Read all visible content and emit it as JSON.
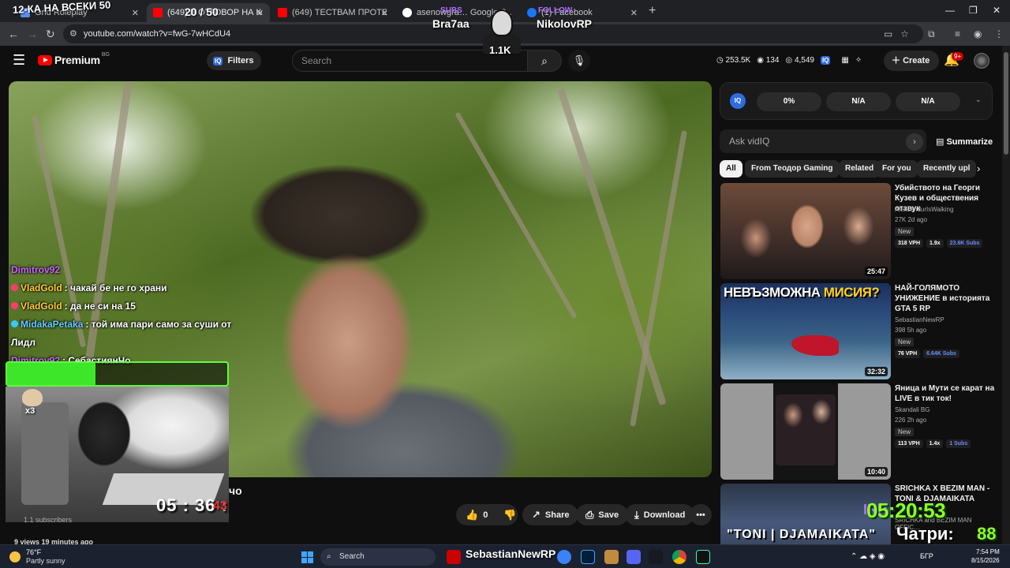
{
  "browser": {
    "tabs": [
      {
        "title": "Grid Roleplay",
        "favicon_color": "#5a8dee"
      },
      {
        "title": "(649) В ОТГОВОР НА КОМ",
        "favicon_color": "#ff0000"
      },
      {
        "title": "(649) ТЕСТВАМ ПРОТЕЙНОВИ",
        "favicon_color": "#ff0000"
      },
      {
        "title": "asenowgra… Google S…",
        "favicon_color": "#ffffff"
      },
      {
        "title": "(1) Facebook",
        "favicon_color": "#1877f2"
      }
    ],
    "url": "youtube.com/watch?v=fwG-7wHCdU4"
  },
  "youtube": {
    "logo_text": "Premium",
    "country_code": "BG",
    "filters_label": "Filters",
    "search_placeholder": "Search",
    "stats": {
      "views": "253.5K",
      "eye": "134",
      "watching": "4,549"
    },
    "create_label": "Create",
    "notifications": "9+"
  },
  "player": {
    "chat": [
      {
        "name": "Dimitrov92",
        "text": "",
        "color": "#cc66ff"
      },
      {
        "name": "VladGold",
        "text": ": чакай бе не го храни",
        "color": "#ffcc33"
      },
      {
        "name": "VladGold",
        "text": ": да не си на 15",
        "color": "#ffcc33"
      },
      {
        "name": "MidakaPetaka",
        "text": ": той има пари само за суши от",
        "color": "#66ccff"
      },
      {
        "name": "",
        "text": "Лидл",
        "color": "#ffffff"
      },
      {
        "name": "Dimitrov92",
        "text": ": СебастиянЧо",
        "color": "#cc66ff"
      }
    ],
    "goal": {
      "label": "12-КА НА ВСЕКИ 50",
      "current": 20,
      "total": 50,
      "count_text": "20 / 50"
    },
    "cat_multiplier": "x3",
    "timer": {
      "hh_mm": "05 : 36 :",
      "sec": "43"
    },
    "streamer_left": "Bra7aa",
    "streamer_left_tag": "SUBS",
    "streamer_right": "NikolovRP",
    "streamer_right_tag": "FOLLOW",
    "mascot_count": "1.1K"
  },
  "video": {
    "title_tail": "чо",
    "subscribers": "1.1 subscribers",
    "views_line": "9 views  19 minutes ago",
    "likes": "0",
    "share_label": "Share",
    "save_label": "Save",
    "download_label": "Download"
  },
  "vidiq": {
    "logo": "IQ",
    "slots": [
      "0%",
      "N/A",
      "N/A"
    ],
    "ask_placeholder": "Ask vidIQ",
    "summarize_label": "Summarize"
  },
  "chips": [
    "All",
    "From Теодор Gaming",
    "Related",
    "For you",
    "Recently upl"
  ],
  "related": [
    {
      "title": "Убийството на Георги Кузев и обществения отзвук",
      "channel": "AleksandurIsWalking",
      "meta": "27K  2d ago",
      "new": "New",
      "vph": "318 VPH",
      "ratio": "1.9x",
      "subs": "23.6K Subs",
      "duration": "25:47"
    },
    {
      "title": "НАЙ-ГОЛЯМОТО УНИЖЕНИЕ в историята GTA 5 RP",
      "channel": "SebastianNewRP",
      "meta": "398  5h ago",
      "new": "New",
      "vph": "76 VPH",
      "ratio": "",
      "subs": "6.64K Subs",
      "duration": "32:32",
      "thumb_title_a": "НЕВЪЗМОЖНА ",
      "thumb_title_b": "МИСИЯ?"
    },
    {
      "title": "Яница и Мути се карат на LIVE в тик ток!",
      "channel": "Skandali BG",
      "meta": "226  2h ago",
      "new": "New",
      "vph": "113 VPH",
      "ratio": "1.4x",
      "subs": "1 Subs",
      "duration": "10:40"
    },
    {
      "title": "SRICHKA X BEZIM MAN - TONI & DJAMAIKATA",
      "channel": "SRICHKA and BEZIM MAN OFFIC…",
      "meta": "",
      "new": "",
      "vph": "",
      "ratio": "",
      "subs": "",
      "duration": "",
      "thumb_title": "\"TONI | DJAMAIKATA\""
    }
  ],
  "overlay_bottom_right": {
    "tag": "IRP",
    "clock": "05:20:53",
    "day_label": "Чатри:",
    "day_value": "88"
  },
  "taskbar": {
    "weather_temp": "76°F",
    "weather_desc": "Partly sunny",
    "search_placeholder": "Search",
    "overlay_name": "SebastianNewRP",
    "lang": "БГР",
    "time": "7:54 PM",
    "date": "8/15/2026"
  }
}
